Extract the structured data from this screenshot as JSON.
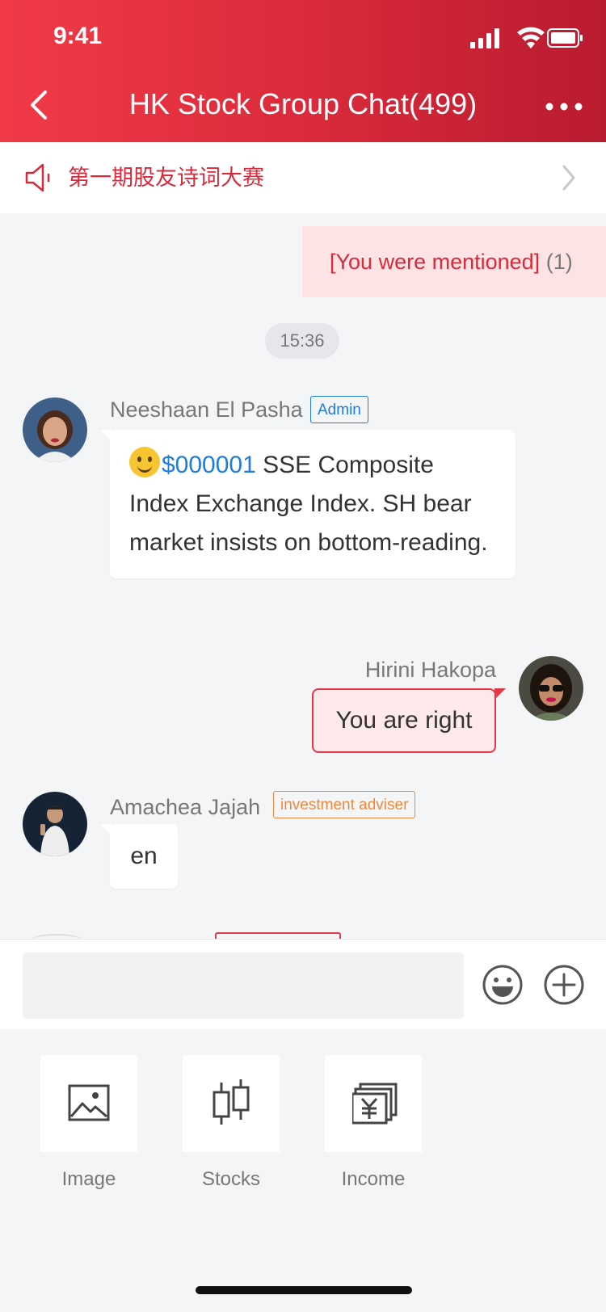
{
  "status_bar": {
    "time": "9:41"
  },
  "nav": {
    "title": "HK Stock Group Chat(499)"
  },
  "notice": {
    "text": "第一期股友诗词大赛"
  },
  "mention": {
    "label": "[You were mentioned]",
    "count": "(1)"
  },
  "timestamp": "15:36",
  "messages": [
    {
      "sender": "Neeshaan El Pasha",
      "badge": "Admin",
      "ticker": "$000001",
      "text": " SSE Composite Index Exchange Index. SH bear market insists on bottom-reading."
    },
    {
      "sender": "Hirini Hakopa",
      "text": "You are right"
    },
    {
      "sender": "Amachea Jajah",
      "badge": "investment adviser",
      "text": "en"
    }
  ],
  "panel": {
    "items": [
      {
        "label": "Image",
        "icon": "image-icon"
      },
      {
        "label": "Stocks",
        "icon": "stocks-icon"
      },
      {
        "label": "Income",
        "icon": "income-icon"
      }
    ]
  },
  "colors": {
    "accent": "#d9293a",
    "link": "#1e7be0",
    "adviser": "#f0883a"
  }
}
